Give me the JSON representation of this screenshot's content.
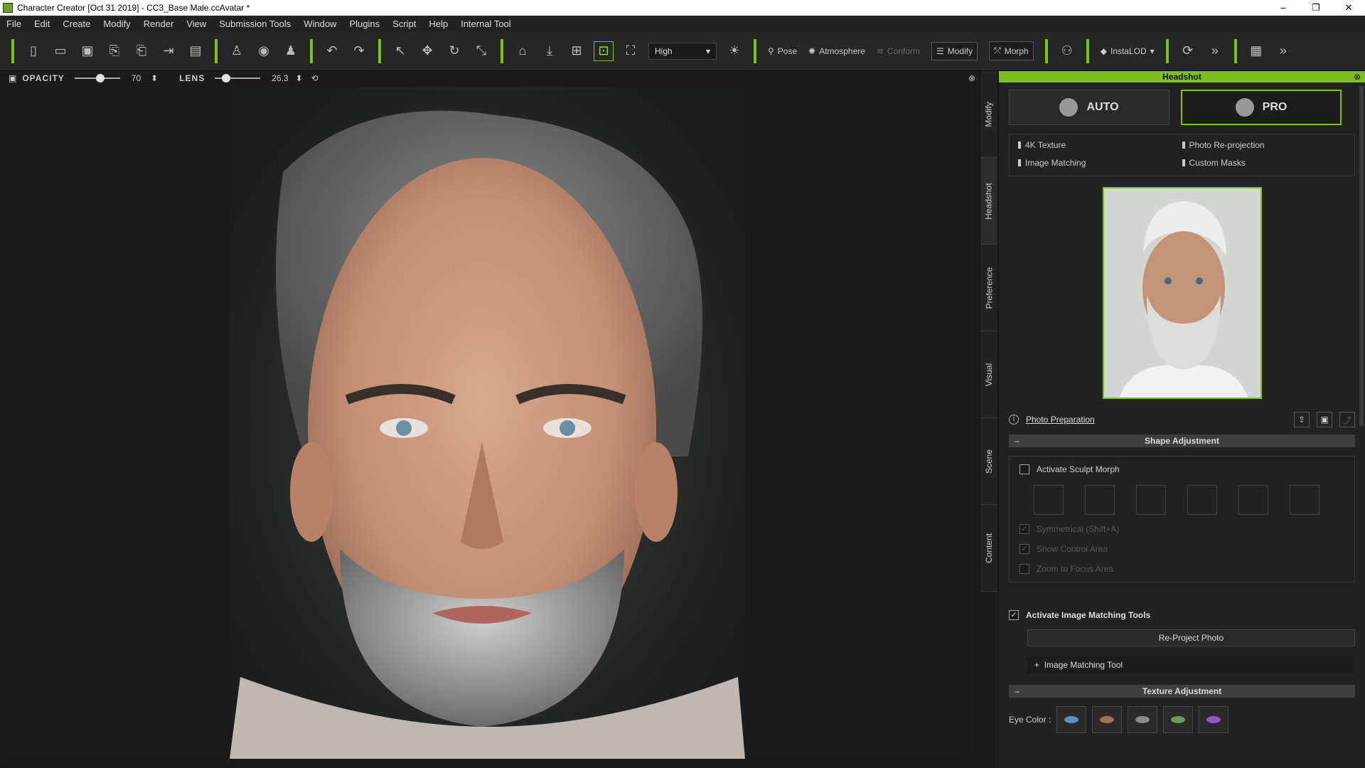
{
  "window": {
    "title": "Character Creator [Oct 31 2019] - CC3_Base Male.ccAvatar *",
    "controls": [
      "–",
      "❐",
      "✕"
    ]
  },
  "menu": [
    "File",
    "Edit",
    "Create",
    "Modify",
    "Render",
    "View",
    "Submission Tools",
    "Window",
    "Plugins",
    "Script",
    "Help",
    "Internal Tool"
  ],
  "toolbar": {
    "quality": "High",
    "pose": "Pose",
    "atmosphere": "Atmosphere",
    "conform": "Conform",
    "modify": "Modify",
    "morph": "Morph",
    "instalod": "InstaLOD"
  },
  "viewbar": {
    "opacity_label": "OPACITY",
    "opacity_value": "70",
    "lens_label": "LENS",
    "lens_value": "26.3"
  },
  "side_tabs": [
    "Modify",
    "Headshot",
    "Preference",
    "Visual",
    "Scene",
    "Content"
  ],
  "panel": {
    "title": "Headshot",
    "auto_label": "AUTO",
    "pro_label": "PRO",
    "features": [
      "4K Texture",
      "Photo Re-projection",
      "Image Matching",
      "Custom Masks"
    ],
    "photo_prep": "Photo Preparation",
    "shape_section": "Shape Adjustment",
    "activate_sculpt": "Activate Sculpt Morph",
    "symmetrical": "Symmetrical (Shift+A)",
    "show_control": "Show Control Area",
    "zoom_focus": "Zoom to Focus Area",
    "activate_img": "Activate Image Matching Tools",
    "reproject": "Re-Project Photo",
    "img_tool": "Image Matching Tool",
    "texture_section": "Texture Adjustment",
    "eye_color_label": "Eye Color :",
    "eye_colors": [
      "#5a8fc8",
      "#a0705a",
      "#8a8a8a",
      "#6a9a5a",
      "#8a5ac8"
    ]
  }
}
